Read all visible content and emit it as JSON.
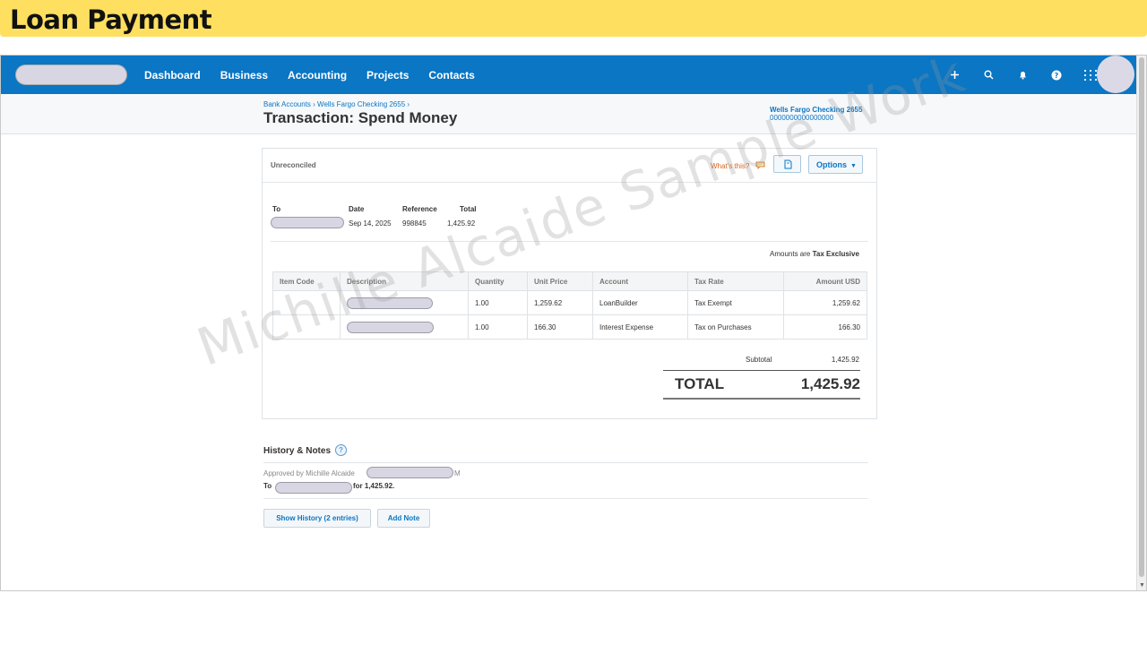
{
  "slide": {
    "title": "Loan Payment"
  },
  "nav": {
    "links": [
      "Dashboard",
      "Business",
      "Accounting",
      "Projects",
      "Contacts"
    ],
    "icons": [
      "plus-icon",
      "search-icon",
      "bell-icon",
      "help-icon",
      "apps-grid-icon"
    ],
    "accent": "#0a76c4"
  },
  "subheader": {
    "breadcrumb": "Bank Accounts › Wells Fargo Checking 2655 ›",
    "title": "Transaction: Spend Money",
    "account_name": "Wells Fargo Checking 2655",
    "account_number": "0000000000000000"
  },
  "transaction": {
    "status": "Unreconciled",
    "whats_this": "What's this?",
    "options_label": "Options",
    "to_label": "To",
    "date_label": "Date",
    "reference_label": "Reference",
    "total_label": "Total",
    "date": "Sep 14, 2025",
    "reference": "998845",
    "total": "1,425.92",
    "amounts_note_prefix": "Amounts are ",
    "amounts_note_bold": "Tax Exclusive",
    "columns": [
      "Item Code",
      "Description",
      "Quantity",
      "Unit Price",
      "Account",
      "Tax Rate",
      "Amount USD"
    ],
    "rows": [
      {
        "item_code": "",
        "quantity": "1.00",
        "unit_price": "1,259.62",
        "account": "LoanBuilder",
        "tax_rate": "Tax Exempt",
        "amount": "1,259.62"
      },
      {
        "item_code": "",
        "quantity": "1.00",
        "unit_price": "166.30",
        "account": "Interest Expense",
        "tax_rate": "Tax on Purchases",
        "amount": "166.30"
      }
    ],
    "subtotal_label": "Subtotal",
    "subtotal": "1,425.92",
    "grand_total_label": "TOTAL",
    "grand_total": "1,425.92"
  },
  "history": {
    "title": "History & Notes",
    "approved_by": "Approved by Michille Alcaide",
    "approved_suffix": "M",
    "to_prefix": "To",
    "for_text": "for 1,425.92.",
    "show_history_label": "Show History (2 entries)",
    "add_note_label": "Add Note"
  },
  "watermark": "Michille Alcaide Sample Work"
}
